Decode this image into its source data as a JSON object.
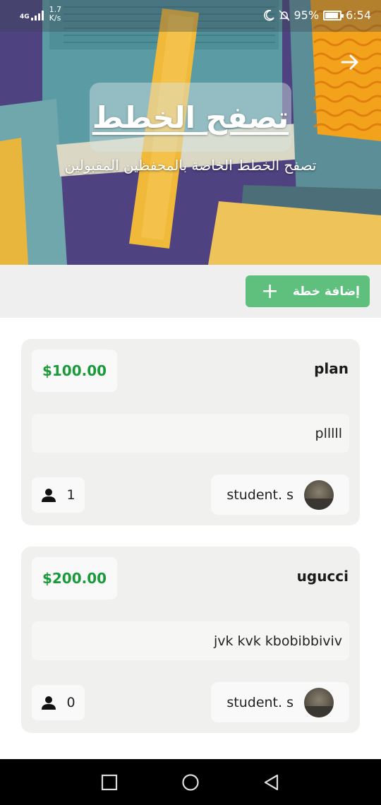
{
  "status_bar": {
    "network": "4G",
    "speed_value": "1.7",
    "speed_unit": "K/s",
    "battery": "95%",
    "time": "6:54"
  },
  "header": {
    "title": "تصفح الخطط",
    "subtitle": "تصفح الخطط الخاصة بالمحفظين المقبولين"
  },
  "actions": {
    "add_plan_label": "إضافة خطة",
    "add_plan_icon": "+"
  },
  "plans": [
    {
      "name": "plan",
      "price": "$100.00",
      "description": "plllll",
      "user": "student. s",
      "count": "1"
    },
    {
      "name": "ugucci",
      "price": "$200.00",
      "description": "jvk kvk kbobibbiviv",
      "user": "student. s",
      "count": "0"
    }
  ],
  "colors": {
    "accent_green": "#5fc07e",
    "price_green": "#1a9a3a",
    "card_bg": "#f0f0ef"
  },
  "icons": {
    "forward": "arrow-right-icon",
    "person": "person-icon",
    "moon": "moon-icon",
    "mute": "bell-off-icon",
    "battery": "battery-icon"
  }
}
